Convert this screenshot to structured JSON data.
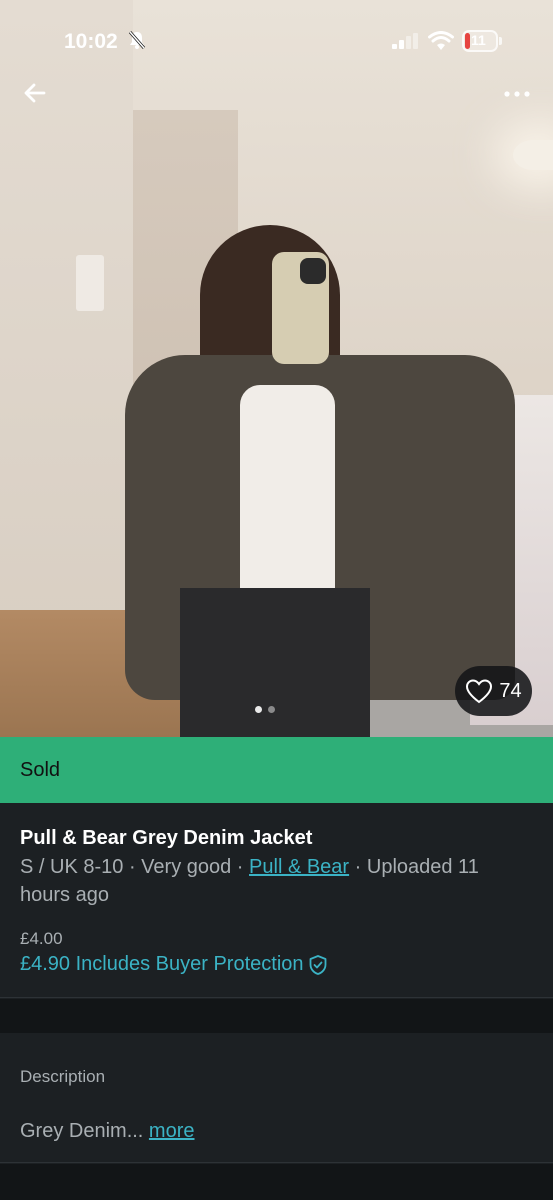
{
  "status_bar": {
    "time": "10:02",
    "battery_level": "11",
    "battery_color": "#e64440"
  },
  "navigation": {
    "back_icon": "arrow-left-icon",
    "more_icon": "more-horizontal-icon"
  },
  "photo": {
    "favourite_count": "74",
    "heart_icon": "heart-outline-icon",
    "page_dots": 2,
    "active_dot": 0
  },
  "sold_banner": {
    "label": "Sold",
    "color": "#2eaf78"
  },
  "item": {
    "title": "Pull & Bear Grey Denim Jacket",
    "size": "S / UK 8-10",
    "separator": " · ",
    "condition": "Very good",
    "brand": "Pull & Bear",
    "uploaded": "Uploaded 11 hours ago",
    "price": "£4.00",
    "total_price": "£4.90 Includes Buyer Protection",
    "shield_icon": "shield-check-icon",
    "accent_color": "#3bb3c5"
  },
  "description": {
    "label": "Description",
    "text": "Grey Denim... ",
    "more_label": "more"
  }
}
